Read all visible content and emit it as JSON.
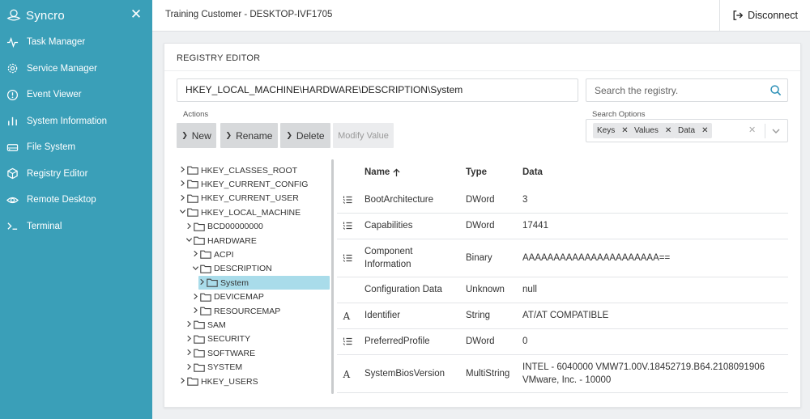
{
  "sidebar": {
    "brand": "Syncro",
    "close_icon": "close-icon",
    "items": [
      {
        "label": "Task Manager",
        "icon": "activity-icon"
      },
      {
        "label": "Service Manager",
        "icon": "gear-icon"
      },
      {
        "label": "Event Viewer",
        "icon": "alert-circle-icon"
      },
      {
        "label": "System Information",
        "icon": "bar-chart-icon"
      },
      {
        "label": "File System",
        "icon": "drive-icon"
      },
      {
        "label": "Registry Editor",
        "icon": "cube-icon"
      },
      {
        "label": "Remote Desktop",
        "icon": "eye-icon"
      },
      {
        "label": "Terminal",
        "icon": "terminal-icon"
      }
    ]
  },
  "header": {
    "title": "Training Customer - DESKTOP-IVF1705",
    "disconnect_label": "Disconnect"
  },
  "card": {
    "title": "REGISTRY EDITOR",
    "path": "HKEY_LOCAL_MACHINE\\HARDWARE\\DESCRIPTION\\System",
    "search_placeholder": "Search the registry.",
    "actions_label": "Actions",
    "buttons": {
      "new": "New",
      "rename": "Rename",
      "delete": "Delete",
      "modify": "Modify Value"
    },
    "search_options_label": "Search Options",
    "search_options": [
      "Keys",
      "Values",
      "Data"
    ]
  },
  "tree": [
    {
      "label": "HKEY_CLASSES_ROOT",
      "level": 0,
      "expanded": false,
      "selected": false
    },
    {
      "label": "HKEY_CURRENT_CONFIG",
      "level": 0,
      "expanded": false,
      "selected": false
    },
    {
      "label": "HKEY_CURRENT_USER",
      "level": 0,
      "expanded": false,
      "selected": false
    },
    {
      "label": "HKEY_LOCAL_MACHINE",
      "level": 0,
      "expanded": true,
      "selected": false
    },
    {
      "label": "BCD00000000",
      "level": 1,
      "expanded": false,
      "selected": false
    },
    {
      "label": "HARDWARE",
      "level": 1,
      "expanded": true,
      "selected": false
    },
    {
      "label": "ACPI",
      "level": 2,
      "expanded": false,
      "selected": false
    },
    {
      "label": "DESCRIPTION",
      "level": 2,
      "expanded": true,
      "selected": false
    },
    {
      "label": "System",
      "level": 3,
      "expanded": false,
      "selected": true
    },
    {
      "label": "DEVICEMAP",
      "level": 2,
      "expanded": false,
      "selected": false
    },
    {
      "label": "RESOURCEMAP",
      "level": 2,
      "expanded": false,
      "selected": false
    },
    {
      "label": "SAM",
      "level": 1,
      "expanded": false,
      "selected": false
    },
    {
      "label": "SECURITY",
      "level": 1,
      "expanded": false,
      "selected": false
    },
    {
      "label": "SOFTWARE",
      "level": 1,
      "expanded": false,
      "selected": false
    },
    {
      "label": "SYSTEM",
      "level": 1,
      "expanded": false,
      "selected": false
    },
    {
      "label": "HKEY_USERS",
      "level": 0,
      "expanded": false,
      "selected": false
    }
  ],
  "table": {
    "columns": {
      "name": "Name",
      "type": "Type",
      "data": "Data"
    },
    "sort_icon": "arrow-up-icon",
    "rows": [
      {
        "name_lines": [
          "BootArchitecture"
        ],
        "type": "DWord",
        "data_lines": [
          "3"
        ],
        "icon": "numeric-list-icon"
      },
      {
        "name_lines": [
          "Capabilities"
        ],
        "type": "DWord",
        "data_lines": [
          "17441"
        ],
        "icon": "numeric-list-icon"
      },
      {
        "name_lines": [
          "Component",
          "Information"
        ],
        "type": "Binary",
        "data_lines": [
          "AAAAAAAAAAAAAAAAAAAAAA=="
        ],
        "icon": "numeric-list-icon"
      },
      {
        "name_lines": [
          "Configuration Data"
        ],
        "type": "Unknown",
        "data_lines": [
          "null"
        ],
        "icon": ""
      },
      {
        "name_lines": [
          "Identifier"
        ],
        "type": "String",
        "data_lines": [
          "AT/AT COMPATIBLE"
        ],
        "icon": "string-icon"
      },
      {
        "name_lines": [
          "PreferredProfile"
        ],
        "type": "DWord",
        "data_lines": [
          "0"
        ],
        "icon": "numeric-list-icon"
      },
      {
        "name_lines": [
          "SystemBiosVersion"
        ],
        "type": "MultiString",
        "data_lines": [
          "INTEL - 6040000 VMW71.00V.18452719.B64.2108091906",
          "VMware, Inc. - 10000"
        ],
        "icon": "string-icon"
      }
    ]
  }
}
